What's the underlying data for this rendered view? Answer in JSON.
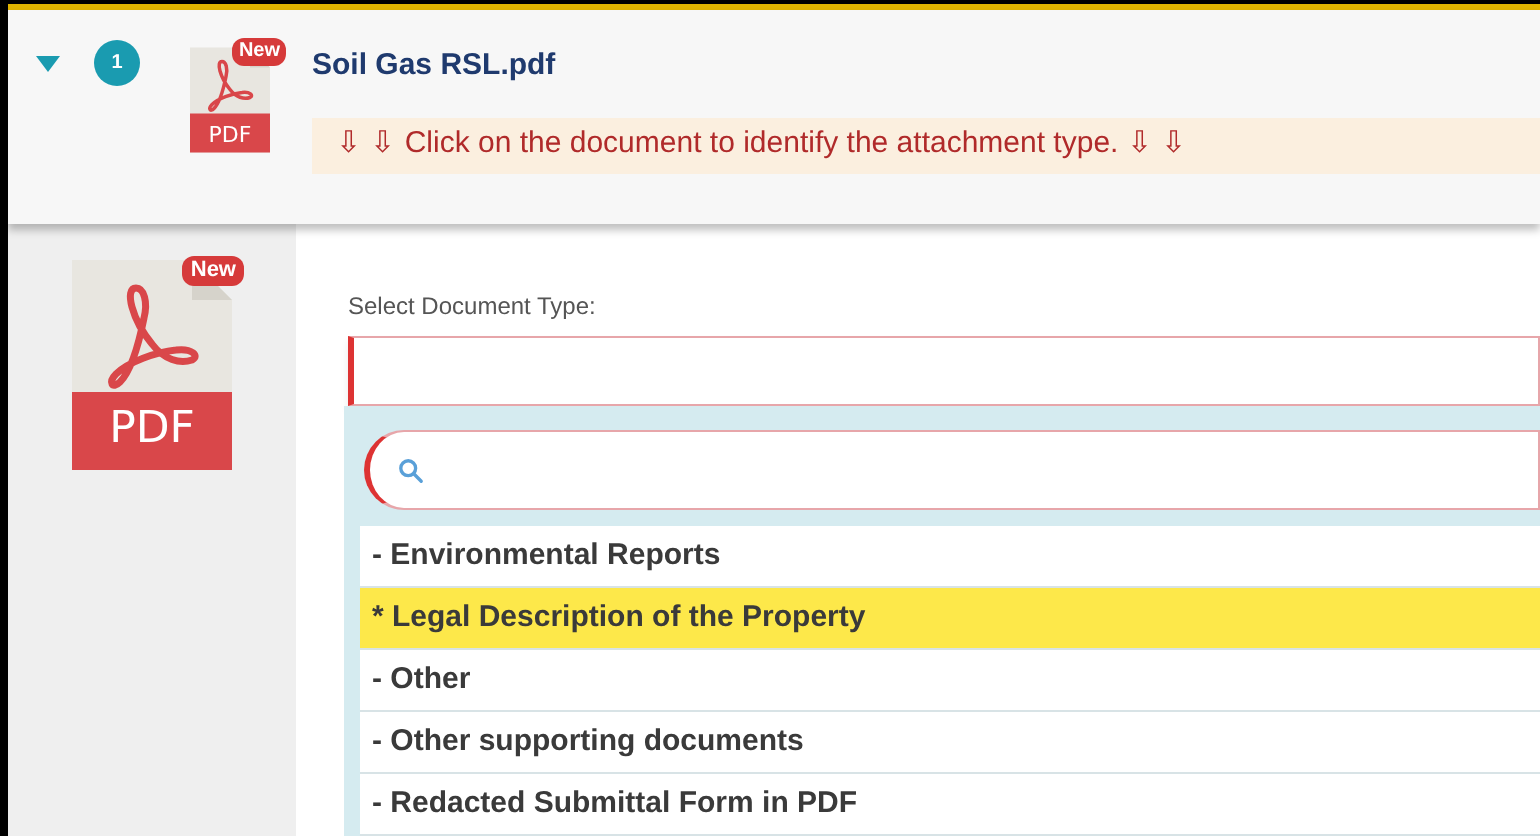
{
  "attachment": {
    "expanded": true,
    "number": "1",
    "badge": "New",
    "file_type": "PDF",
    "file_name": "Soil Gas RSL.pdf",
    "message": "⇩ ⇩ Click on the document to identify the attachment type. ⇩ ⇩"
  },
  "preview": {
    "badge": "New",
    "file_type": "PDF"
  },
  "document_type": {
    "label": "Select Document Type:",
    "options": [
      {
        "label": "- Environmental Reports",
        "selected": false
      },
      {
        "label": "* Legal Description of the Property",
        "selected": true
      },
      {
        "label": "- Other",
        "selected": false
      },
      {
        "label": "- Other supporting documents",
        "selected": false
      },
      {
        "label": "- Redacted Submittal Form in PDF",
        "selected": false
      }
    ]
  }
}
